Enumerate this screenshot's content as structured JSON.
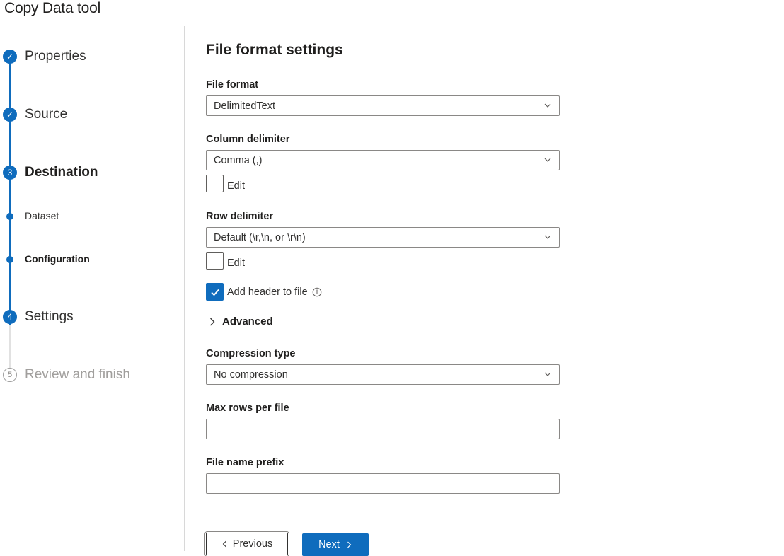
{
  "header": {
    "title": "Copy Data tool"
  },
  "steps": [
    {
      "number": "✓",
      "label": "Properties",
      "state": "completed"
    },
    {
      "number": "✓",
      "label": "Source",
      "state": "completed"
    },
    {
      "number": "3",
      "label": "Destination",
      "state": "current"
    },
    {
      "label": "Dataset",
      "state": "substep"
    },
    {
      "label": "Configuration",
      "state": "current-substep"
    },
    {
      "number": "4",
      "label": "Settings",
      "state": "upcoming"
    },
    {
      "number": "5",
      "label": "Review and finish",
      "state": "disabled"
    }
  ],
  "form": {
    "title": "File format settings",
    "file_format": {
      "label": "File format",
      "value": "DelimitedText"
    },
    "column_delimiter": {
      "label": "Column delimiter",
      "value": "Comma (,)",
      "edit_label": "Edit",
      "edit_checked": false
    },
    "row_delimiter": {
      "label": "Row delimiter",
      "value": "Default (\\r,\\n, or \\r\\n)",
      "edit_label": "Edit",
      "edit_checked": false
    },
    "add_header": {
      "label": "Add header to file",
      "checked": true
    },
    "advanced": {
      "label": "Advanced"
    },
    "compression_type": {
      "label": "Compression type",
      "value": "No compression"
    },
    "max_rows": {
      "label": "Max rows per file",
      "value": ""
    },
    "file_name_prefix": {
      "label": "File name prefix",
      "value": ""
    }
  },
  "footer": {
    "previous_label": "Previous",
    "next_label": "Next"
  },
  "colors": {
    "accent": "#0f6cbd",
    "border": "#8a8886",
    "disabled": "#a19f9d"
  }
}
